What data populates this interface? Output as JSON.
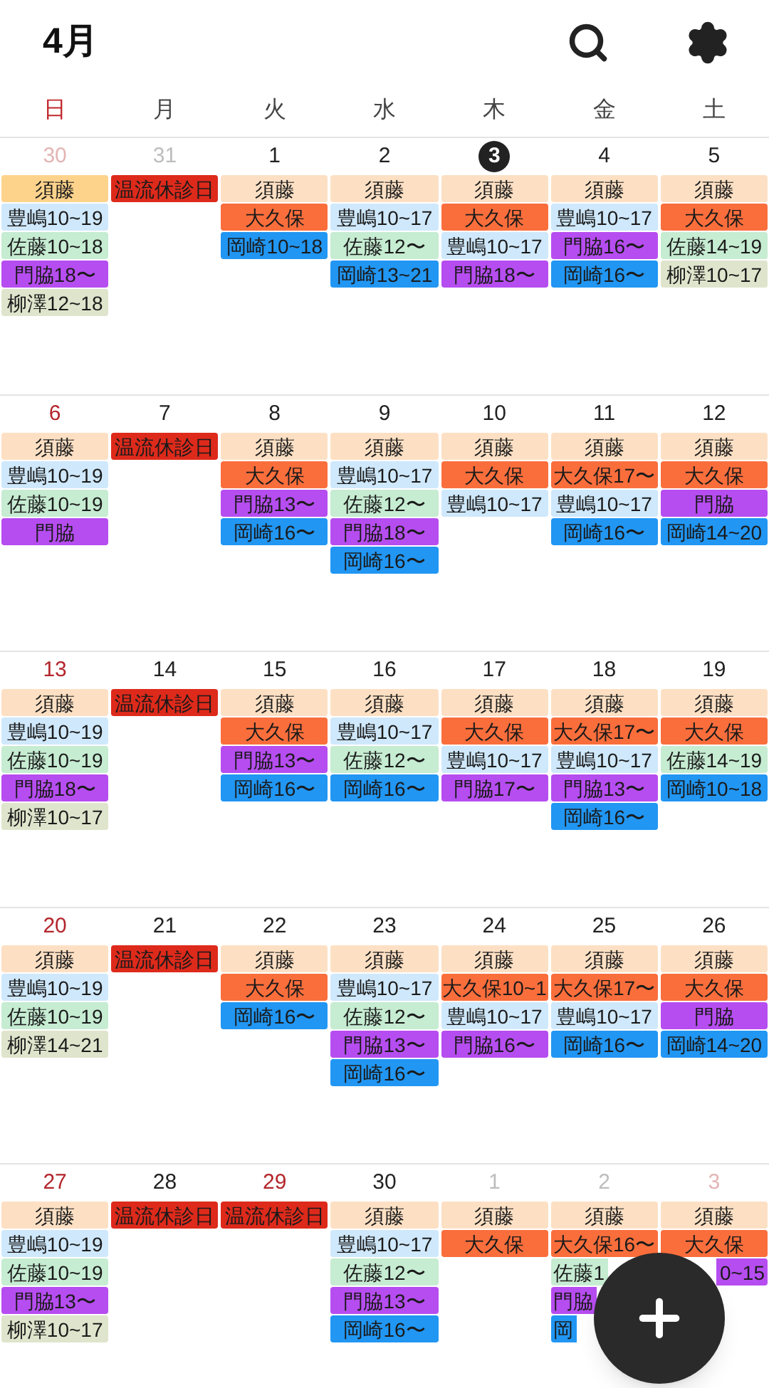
{
  "header": {
    "title": "4月"
  },
  "weekdays": [
    "日",
    "月",
    "火",
    "水",
    "木",
    "金",
    "土"
  ],
  "weeks": [
    {
      "days": [
        {
          "date": "30",
          "kind": "other",
          "events": [
            {
              "text": "須藤",
              "color": "#fdd38c"
            },
            {
              "text": "豊嶋10~19",
              "color": "#cfe8fb"
            },
            {
              "text": "佐藤10~18",
              "color": "#c6ecd2"
            },
            {
              "text": "門脇18〜",
              "color": "#b64df0"
            },
            {
              "text": "柳澤12~18",
              "color": "#dfe4cc"
            }
          ]
        },
        {
          "date": "31",
          "kind": "other",
          "events": [
            {
              "text": "温流休診日",
              "color": "#dd2a1b"
            }
          ]
        },
        {
          "date": "1",
          "kind": "normal",
          "events": [
            {
              "text": "須藤",
              "color": "#fde0c4"
            },
            {
              "text": "大久保",
              "color": "#fa6e3c"
            },
            {
              "text": "岡崎10~18",
              "color": "#2196f3"
            }
          ]
        },
        {
          "date": "2",
          "kind": "normal",
          "events": [
            {
              "text": "須藤",
              "color": "#fde0c4"
            },
            {
              "text": "豊嶋10~17",
              "color": "#cfe8fb"
            },
            {
              "text": "佐藤12〜",
              "color": "#c6ecd2"
            },
            {
              "text": "岡崎13~21",
              "color": "#2196f3"
            }
          ]
        },
        {
          "date": "3",
          "kind": "today",
          "events": [
            {
              "text": "須藤",
              "color": "#fde0c4"
            },
            {
              "text": "大久保",
              "color": "#fa6e3c"
            },
            {
              "text": "豊嶋10~17",
              "color": "#cfe8fb"
            },
            {
              "text": "門脇18〜",
              "color": "#b64df0"
            }
          ]
        },
        {
          "date": "4",
          "kind": "normal",
          "events": [
            {
              "text": "須藤",
              "color": "#fde0c4"
            },
            {
              "text": "豊嶋10~17",
              "color": "#cfe8fb"
            },
            {
              "text": "門脇16〜",
              "color": "#b64df0"
            },
            {
              "text": "岡崎16〜",
              "color": "#2196f3"
            }
          ]
        },
        {
          "date": "5",
          "kind": "normal",
          "events": [
            {
              "text": "須藤",
              "color": "#fde0c4"
            },
            {
              "text": "大久保",
              "color": "#fa6e3c"
            },
            {
              "text": "佐藤14~19",
              "color": "#c6ecd2"
            },
            {
              "text": "柳澤10~17",
              "color": "#dfe4cc"
            }
          ]
        }
      ]
    },
    {
      "days": [
        {
          "date": "6",
          "kind": "normal",
          "events": [
            {
              "text": "須藤",
              "color": "#fde0c4"
            },
            {
              "text": "豊嶋10~19",
              "color": "#cfe8fb"
            },
            {
              "text": "佐藤10~19",
              "color": "#c6ecd2"
            },
            {
              "text": "門脇",
              "color": "#b64df0"
            }
          ]
        },
        {
          "date": "7",
          "kind": "normal",
          "events": [
            {
              "text": "温流休診日",
              "color": "#dd2a1b"
            }
          ]
        },
        {
          "date": "8",
          "kind": "normal",
          "events": [
            {
              "text": "須藤",
              "color": "#fde0c4"
            },
            {
              "text": "大久保",
              "color": "#fa6e3c"
            },
            {
              "text": "門脇13〜",
              "color": "#b64df0"
            },
            {
              "text": "岡崎16〜",
              "color": "#2196f3"
            }
          ]
        },
        {
          "date": "9",
          "kind": "normal",
          "events": [
            {
              "text": "須藤",
              "color": "#fde0c4"
            },
            {
              "text": "豊嶋10~17",
              "color": "#cfe8fb"
            },
            {
              "text": "佐藤12〜",
              "color": "#c6ecd2"
            },
            {
              "text": "門脇18〜",
              "color": "#b64df0"
            },
            {
              "text": "岡崎16〜",
              "color": "#2196f3"
            }
          ]
        },
        {
          "date": "10",
          "kind": "normal",
          "events": [
            {
              "text": "須藤",
              "color": "#fde0c4"
            },
            {
              "text": "大久保",
              "color": "#fa6e3c"
            },
            {
              "text": "豊嶋10~17",
              "color": "#cfe8fb"
            }
          ]
        },
        {
          "date": "11",
          "kind": "normal",
          "events": [
            {
              "text": "須藤",
              "color": "#fde0c4"
            },
            {
              "text": "大久保17〜",
              "color": "#fa6e3c"
            },
            {
              "text": "豊嶋10~17",
              "color": "#cfe8fb"
            },
            {
              "text": "岡崎16〜",
              "color": "#2196f3"
            }
          ]
        },
        {
          "date": "12",
          "kind": "normal",
          "events": [
            {
              "text": "須藤",
              "color": "#fde0c4"
            },
            {
              "text": "大久保",
              "color": "#fa6e3c"
            },
            {
              "text": "門脇",
              "color": "#b64df0"
            },
            {
              "text": "岡崎14~20",
              "color": "#2196f3"
            }
          ]
        }
      ]
    },
    {
      "days": [
        {
          "date": "13",
          "kind": "normal",
          "events": [
            {
              "text": "須藤",
              "color": "#fde0c4"
            },
            {
              "text": "豊嶋10~19",
              "color": "#cfe8fb"
            },
            {
              "text": "佐藤10~19",
              "color": "#c6ecd2"
            },
            {
              "text": "門脇18〜",
              "color": "#b64df0"
            },
            {
              "text": "柳澤10~17",
              "color": "#dfe4cc"
            }
          ]
        },
        {
          "date": "14",
          "kind": "normal",
          "events": [
            {
              "text": "温流休診日",
              "color": "#dd2a1b"
            }
          ]
        },
        {
          "date": "15",
          "kind": "normal",
          "events": [
            {
              "text": "須藤",
              "color": "#fde0c4"
            },
            {
              "text": "大久保",
              "color": "#fa6e3c"
            },
            {
              "text": "門脇13〜",
              "color": "#b64df0"
            },
            {
              "text": "岡崎16〜",
              "color": "#2196f3"
            }
          ]
        },
        {
          "date": "16",
          "kind": "normal",
          "events": [
            {
              "text": "須藤",
              "color": "#fde0c4"
            },
            {
              "text": "豊嶋10~17",
              "color": "#cfe8fb"
            },
            {
              "text": "佐藤12〜",
              "color": "#c6ecd2"
            },
            {
              "text": "岡崎16〜",
              "color": "#2196f3"
            }
          ]
        },
        {
          "date": "17",
          "kind": "normal",
          "events": [
            {
              "text": "須藤",
              "color": "#fde0c4"
            },
            {
              "text": "大久保",
              "color": "#fa6e3c"
            },
            {
              "text": "豊嶋10~17",
              "color": "#cfe8fb"
            },
            {
              "text": "門脇17〜",
              "color": "#b64df0"
            }
          ]
        },
        {
          "date": "18",
          "kind": "normal",
          "events": [
            {
              "text": "須藤",
              "color": "#fde0c4"
            },
            {
              "text": "大久保17〜",
              "color": "#fa6e3c"
            },
            {
              "text": "豊嶋10~17",
              "color": "#cfe8fb"
            },
            {
              "text": "門脇13〜",
              "color": "#b64df0"
            },
            {
              "text": "岡崎16〜",
              "color": "#2196f3"
            }
          ]
        },
        {
          "date": "19",
          "kind": "normal",
          "events": [
            {
              "text": "須藤",
              "color": "#fde0c4"
            },
            {
              "text": "大久保",
              "color": "#fa6e3c"
            },
            {
              "text": "佐藤14~19",
              "color": "#c6ecd2"
            },
            {
              "text": "岡崎10~18",
              "color": "#2196f3"
            }
          ]
        }
      ]
    },
    {
      "days": [
        {
          "date": "20",
          "kind": "normal",
          "events": [
            {
              "text": "須藤",
              "color": "#fde0c4"
            },
            {
              "text": "豊嶋10~19",
              "color": "#cfe8fb"
            },
            {
              "text": "佐藤10~19",
              "color": "#c6ecd2"
            },
            {
              "text": "柳澤14~21",
              "color": "#dfe4cc"
            }
          ]
        },
        {
          "date": "21",
          "kind": "normal",
          "events": [
            {
              "text": "温流休診日",
              "color": "#dd2a1b"
            }
          ]
        },
        {
          "date": "22",
          "kind": "normal",
          "events": [
            {
              "text": "須藤",
              "color": "#fde0c4"
            },
            {
              "text": "大久保",
              "color": "#fa6e3c"
            },
            {
              "text": "岡崎16〜",
              "color": "#2196f3"
            }
          ]
        },
        {
          "date": "23",
          "kind": "normal",
          "events": [
            {
              "text": "須藤",
              "color": "#fde0c4"
            },
            {
              "text": "豊嶋10~17",
              "color": "#cfe8fb"
            },
            {
              "text": "佐藤12〜",
              "color": "#c6ecd2"
            },
            {
              "text": "門脇13〜",
              "color": "#b64df0"
            },
            {
              "text": "岡崎16〜",
              "color": "#2196f3"
            }
          ]
        },
        {
          "date": "24",
          "kind": "normal",
          "events": [
            {
              "text": "須藤",
              "color": "#fde0c4"
            },
            {
              "text": "大久保10~1",
              "color": "#fa6e3c"
            },
            {
              "text": "豊嶋10~17",
              "color": "#cfe8fb"
            },
            {
              "text": "門脇16〜",
              "color": "#b64df0"
            }
          ]
        },
        {
          "date": "25",
          "kind": "normal",
          "events": [
            {
              "text": "須藤",
              "color": "#fde0c4"
            },
            {
              "text": "大久保17〜",
              "color": "#fa6e3c"
            },
            {
              "text": "豊嶋10~17",
              "color": "#cfe8fb"
            },
            {
              "text": "岡崎16〜",
              "color": "#2196f3"
            }
          ]
        },
        {
          "date": "26",
          "kind": "normal",
          "events": [
            {
              "text": "須藤",
              "color": "#fde0c4"
            },
            {
              "text": "大久保",
              "color": "#fa6e3c"
            },
            {
              "text": "門脇",
              "color": "#b64df0"
            },
            {
              "text": "岡崎14~20",
              "color": "#2196f3"
            }
          ]
        }
      ]
    },
    {
      "days": [
        {
          "date": "27",
          "kind": "normal",
          "events": [
            {
              "text": "須藤",
              "color": "#fde0c4"
            },
            {
              "text": "豊嶋10~19",
              "color": "#cfe8fb"
            },
            {
              "text": "佐藤10~19",
              "color": "#c6ecd2"
            },
            {
              "text": "門脇13〜",
              "color": "#b64df0"
            },
            {
              "text": "柳澤10~17",
              "color": "#dfe4cc"
            }
          ]
        },
        {
          "date": "28",
          "kind": "normal",
          "events": [
            {
              "text": "温流休診日",
              "color": "#dd2a1b"
            }
          ]
        },
        {
          "date": "29",
          "kind": "holiday",
          "events": [
            {
              "text": "温流休診日",
              "color": "#dd2a1b"
            }
          ]
        },
        {
          "date": "30",
          "kind": "normal",
          "events": [
            {
              "text": "須藤",
              "color": "#fde0c4"
            },
            {
              "text": "豊嶋10~17",
              "color": "#cfe8fb"
            },
            {
              "text": "佐藤12〜",
              "color": "#c6ecd2"
            },
            {
              "text": "門脇13〜",
              "color": "#b64df0"
            },
            {
              "text": "岡崎16〜",
              "color": "#2196f3"
            }
          ]
        },
        {
          "date": "1",
          "kind": "other",
          "events": [
            {
              "text": "須藤",
              "color": "#fde0c4"
            },
            {
              "text": "大久保",
              "color": "#fa6e3c"
            }
          ]
        },
        {
          "date": "2",
          "kind": "other",
          "events": [
            {
              "text": "須藤",
              "color": "#fde0c4"
            },
            {
              "text": "大久保16〜",
              "color": "#fa6e3c"
            },
            {
              "text": "佐藤1",
              "color": "#c6ecd2",
              "kind": "clipped_end"
            },
            {
              "text": "門脇",
              "color": "#b64df0",
              "kind": "clipped_end"
            },
            {
              "text": "岡",
              "color": "#2196f3",
              "kind": "clipped_end"
            }
          ]
        },
        {
          "date": "3",
          "kind": "other_holiday",
          "events": [
            {
              "text": "須藤",
              "color": "#fde0c4"
            },
            {
              "text": "大久保",
              "color": "#fa6e3c"
            },
            {
              "text": "0~15",
              "color": "#b64df0",
              "kind": "clipped_start"
            }
          ]
        }
      ]
    }
  ]
}
